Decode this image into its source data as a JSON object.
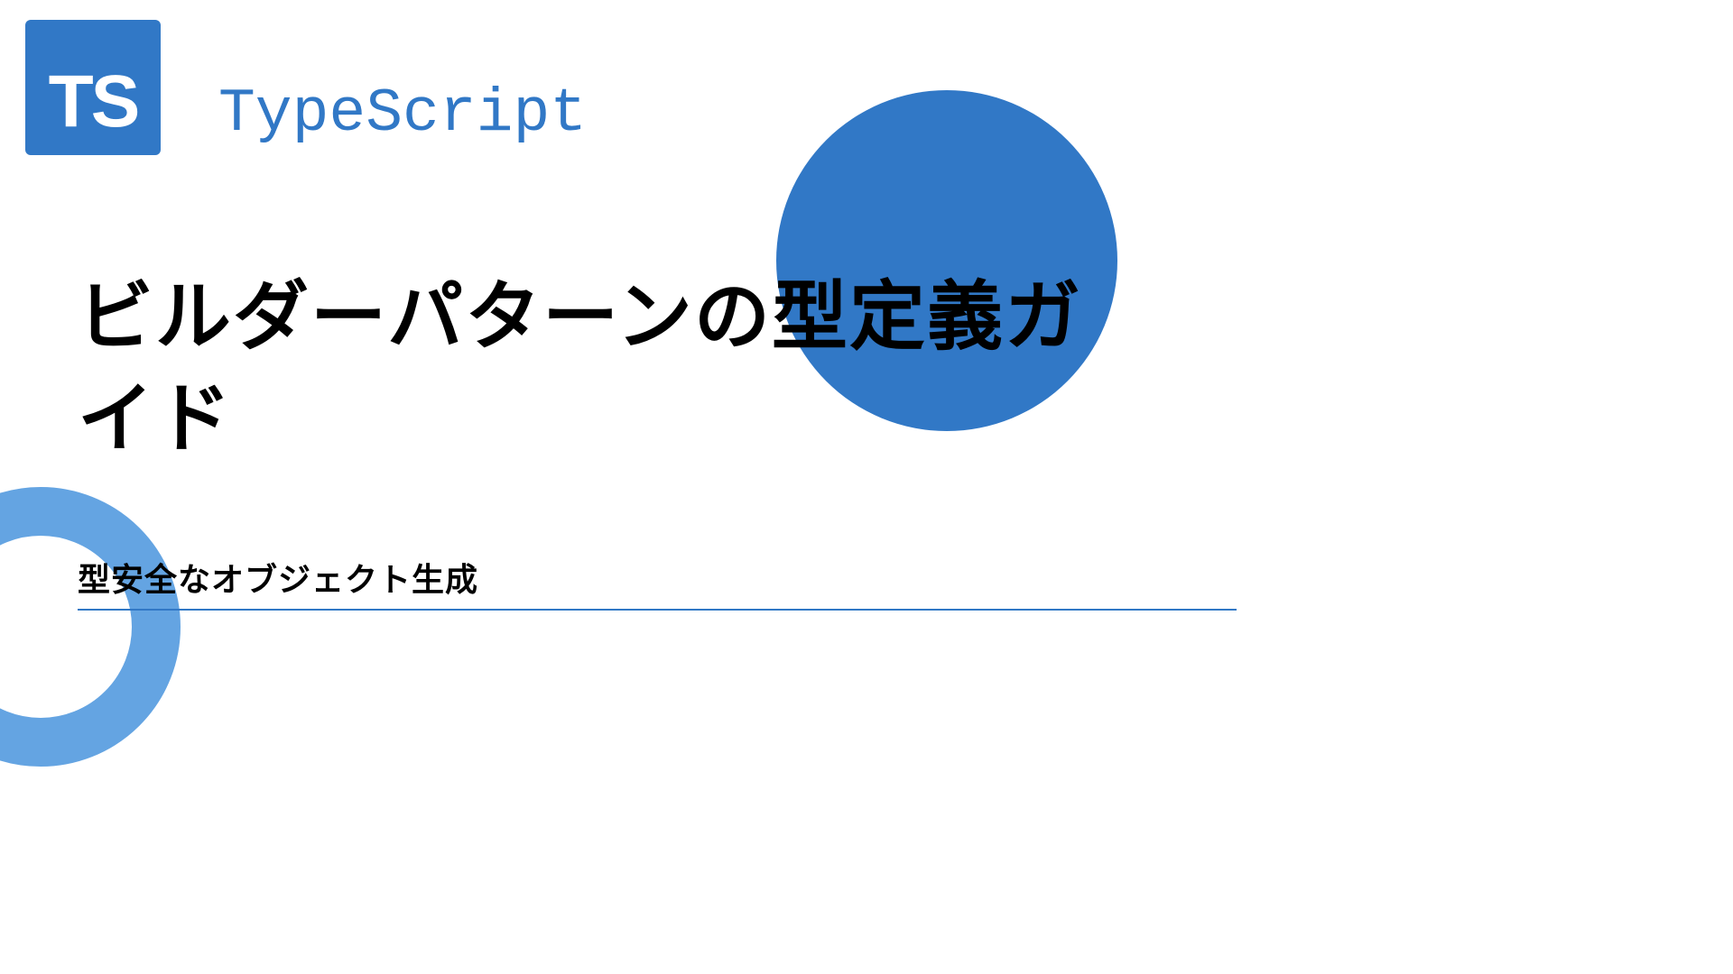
{
  "logo": {
    "text": "TS",
    "label": "TypeScript"
  },
  "title": "ビルダーパターンの型定義ガイド",
  "subtitle": "型安全なオブジェクト生成"
}
